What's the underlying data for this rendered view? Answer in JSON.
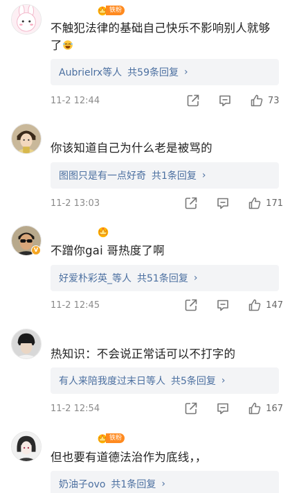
{
  "comments": [
    {
      "badge": "铁粉",
      "text": "不触犯法律的基础自己快乐不影响别人就够了",
      "reply_who": "Aubrielrx等人",
      "reply_count": "共59条回复",
      "time": "11-2 12:44",
      "likes": "73"
    },
    {
      "text": "你该知道自己为什么老是被骂的",
      "reply_who": "图图只是有一点好奇",
      "reply_count": "共1条回复",
      "time": "11-2 13:03",
      "likes": "171"
    },
    {
      "text": "不蹭你gai 哥热度了啊",
      "reply_who": "好爱朴彩英_等人",
      "reply_count": "共51条回复",
      "time": "11-2 12:45",
      "likes": "147"
    },
    {
      "text": "热知识：不会说正常话可以不打字的",
      "reply_who": "有人来陪我度过末日等人",
      "reply_count": "共5条回复",
      "time": "11-2 12:54",
      "likes": "167"
    },
    {
      "badge": "铁粉",
      "text": "但也要有道德法治作为底线，，",
      "reply_who": "奶油子ovo",
      "reply_count": "共1条回复"
    }
  ],
  "colors": {
    "link": "#4b6fa0",
    "reply_bg": "#f3f4f6",
    "fan_badge": "#ff8a1f",
    "meta": "#8a8a8a"
  },
  "icons": [
    "share-icon",
    "comment-icon",
    "thumbs-up-icon",
    "crown-icon",
    "verified-icon"
  ]
}
